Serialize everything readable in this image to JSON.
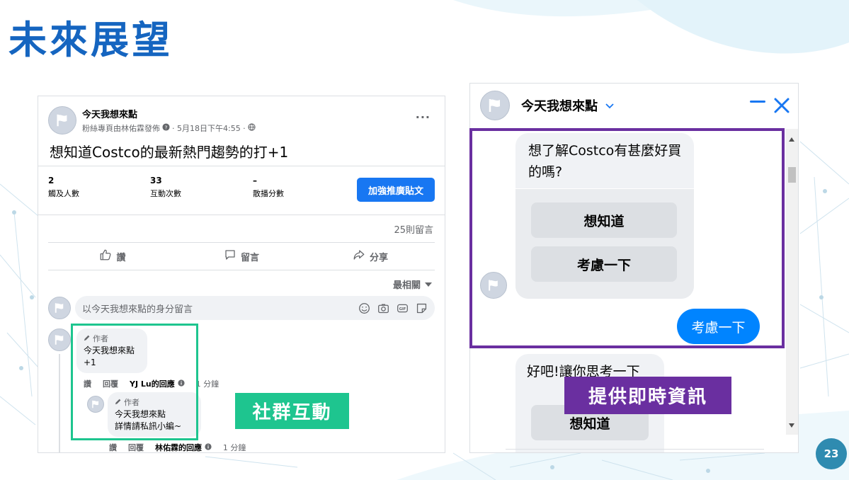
{
  "slide": {
    "title": "未來展望",
    "page_number": "23"
  },
  "fb_post": {
    "page_name": "今天我想來點",
    "subtitle_prefix": "粉絲專頁由林佑霖發佈",
    "date": "· 5月18日下午4:55 ·",
    "more": "···",
    "text": "想知道Costco的最新熱門趨勢的打+1",
    "stats": [
      {
        "value": "2",
        "label": "觸及人數"
      },
      {
        "value": "33",
        "label": "互動次數"
      },
      {
        "value": "–",
        "label": "散播分數"
      }
    ],
    "boost_label": "加強推廣貼文",
    "comment_count": "25則留言",
    "actions": [
      {
        "label": "讚",
        "icon": "thumbs-up-icon"
      },
      {
        "label": "留言",
        "icon": "comment-icon"
      },
      {
        "label": "分享",
        "icon": "share-icon"
      }
    ],
    "sort_label": "最相關",
    "comment_placeholder": "以今天我想來點的身分留言",
    "comments": [
      {
        "author_tag": "作者",
        "name": "今天我想來點",
        "text": "+1",
        "actions": [
          "讚",
          "回覆"
        ],
        "reply_by": "YJ Lu的回應",
        "time": "1 分鐘"
      },
      {
        "author_tag": "作者",
        "name": "今天我想來點",
        "text": "詳情請私訊小編~",
        "actions": [
          "讚",
          "回覆"
        ],
        "reply_by": "林佑霖的回應",
        "time": "1 分鐘"
      }
    ],
    "highlight_label": "社群互動",
    "highlight_color": "#1ec58f"
  },
  "messenger": {
    "name": "今天我想來點",
    "bot_question": "想了解Costco有甚麼好買的嗎?",
    "quick_replies": [
      "想知道",
      "考慮一下"
    ],
    "user_reply": "考慮一下",
    "bot_followup": "好吧!讓你思考一下",
    "followup_reply": "想知道",
    "highlight_label": "提供即時資訊",
    "highlight_color": "#6a2fa0",
    "accent": "#0084ff"
  }
}
